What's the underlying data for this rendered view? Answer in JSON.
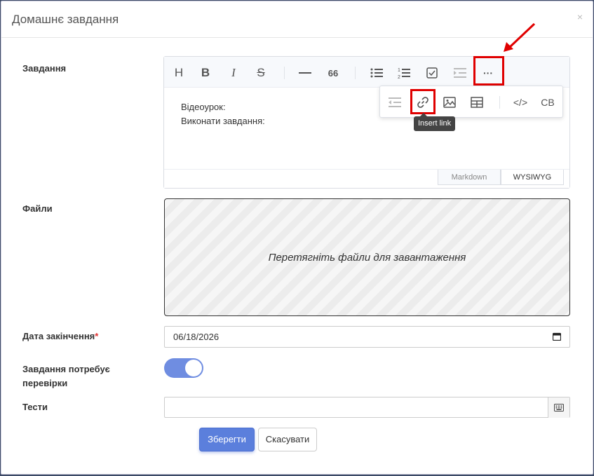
{
  "modal": {
    "title": "Домашнє завдання",
    "close": "×"
  },
  "fields": {
    "task_label": "Завдання",
    "files_label": "Файли",
    "due_label": "Дата закінчення",
    "required_mark": "*",
    "review_label": "Завдання потребує перевірки",
    "tests_label": "Тести"
  },
  "editor": {
    "toolbar": [
      "heading-icon",
      "bold-icon",
      "italic-icon",
      "strike-icon",
      "hr-icon",
      "quote-icon",
      "bullet-list-icon",
      "ordered-list-icon",
      "task-list-icon",
      "indent-icon",
      "more-icon"
    ],
    "heading": "H",
    "bold": "B",
    "italic": "I",
    "strike": "S",
    "quote": "66",
    "more": "···",
    "lines": [
      "Відеоурок:",
      "Виконати завдання:"
    ],
    "mode_markdown": "Markdown",
    "mode_wysiwyg": "WYSIWYG",
    "popup": [
      "outdent-icon",
      "link-icon",
      "image-icon",
      "table-icon",
      "code-icon",
      "codeblock-icon"
    ],
    "code": "</>",
    "codeblock": "CB",
    "tooltip": "Insert link"
  },
  "dropzone": {
    "text": "Перетягніть файли для завантаження"
  },
  "due_date": {
    "value": "06/18/2026"
  },
  "review_toggle": {
    "on": true
  },
  "tests": {
    "value": ""
  },
  "buttons": {
    "save": "Зберегти",
    "cancel": "Скасувати"
  },
  "colors": {
    "primary": "#5b7fdc",
    "highlight": "#e00000",
    "required": "#e03030"
  }
}
